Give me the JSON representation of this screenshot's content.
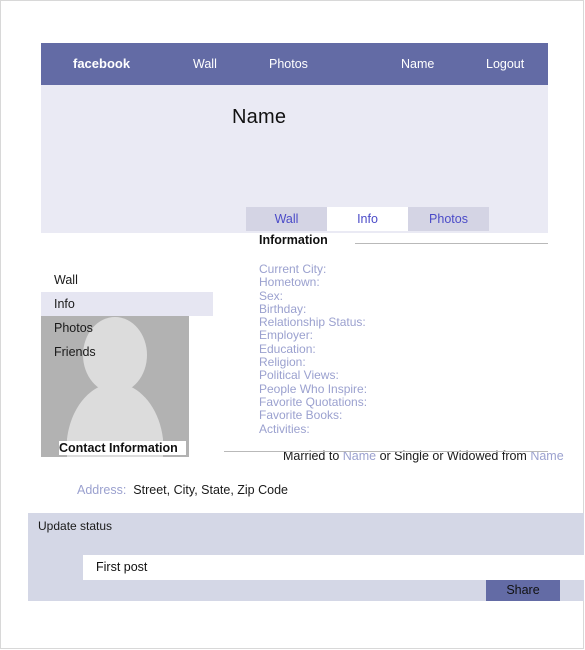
{
  "top_nav": {
    "brand": "facebook",
    "links": [
      {
        "label": "Wall"
      },
      {
        "label": "Photos"
      },
      {
        "label": "Name"
      },
      {
        "label": "Logout"
      }
    ]
  },
  "profile": {
    "name": "Name",
    "avatar_icon": "user-silhouette-icon"
  },
  "tabs": [
    {
      "label": "Wall",
      "active": false
    },
    {
      "label": "Info",
      "active": true
    },
    {
      "label": "Photos",
      "active": false
    }
  ],
  "sidebar": {
    "items": [
      {
        "label": "Wall",
        "active": false
      },
      {
        "label": "Info",
        "active": true
      },
      {
        "label": "Photos",
        "active": false
      },
      {
        "label": "Friends",
        "active": false
      }
    ]
  },
  "information": {
    "title": "Information",
    "fields": [
      "Current City:",
      "Hometown:",
      "Sex:",
      "Birthday:",
      "Relationship Status:",
      "Employer:",
      "Education:",
      "Religion:",
      "Political Views:",
      "People Who Inspire:",
      "Favorite Quotations:",
      "Favorite Books:",
      "Activities:"
    ],
    "relationship_line": {
      "part1": "Married to ",
      "name1": "Name",
      "part2": " or Single or Widowed from ",
      "name2": "Name"
    }
  },
  "contact": {
    "title": "Contact Information",
    "address_label": "Address:",
    "address_value": "Street, City, State, Zip Code"
  },
  "status": {
    "title": "Update status",
    "input_value": "First post",
    "share_label": "Share"
  },
  "colors": {
    "nav_purple": "#636ba5",
    "header_lavender": "#eaeaf4",
    "tab_inactive": "#d4d4e4",
    "tab_text": "#4b4bc8",
    "field_label": "#9ba1cf",
    "status_bar": "#d4d7e6",
    "sidebar_active": "#e6e6f2"
  }
}
